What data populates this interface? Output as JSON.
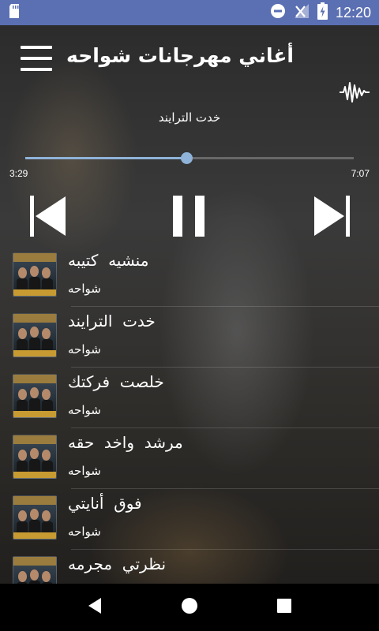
{
  "status_bar": {
    "time": "12:20",
    "icons": [
      "sd-card-icon",
      "do-not-disturb-icon",
      "no-signal-icon",
      "battery-charging-icon"
    ],
    "background": "#5b6fb3"
  },
  "app_bar": {
    "title": "أغاني مهرجانات شواحه",
    "menu_icon": "menu-icon"
  },
  "player": {
    "now_playing": "خدت الترايند",
    "current_time": "3:29",
    "total_time": "7:07",
    "progress": 0.49,
    "accent": "#8fb3d9",
    "controls": [
      "skip-previous-icon",
      "pause-icon",
      "skip-next-icon"
    ]
  },
  "songs": [
    {
      "title": "منشيه  كتيبه",
      "artist": "شواحه",
      "playing": false
    },
    {
      "title": "خدت  الترايند",
      "artist": "شواحه",
      "playing": true
    },
    {
      "title": "خلصت  فركتك",
      "artist": "شواحه",
      "playing": false
    },
    {
      "title": "مرشد  واخد  حقه",
      "artist": "شواحه",
      "playing": false
    },
    {
      "title": "فوق  أنايتي",
      "artist": "شواحه",
      "playing": false
    },
    {
      "title": "نظرتي  مجرمه",
      "artist": "شواحه",
      "playing": false
    }
  ],
  "nav_bar": [
    "back-icon",
    "home-icon",
    "recents-icon"
  ]
}
